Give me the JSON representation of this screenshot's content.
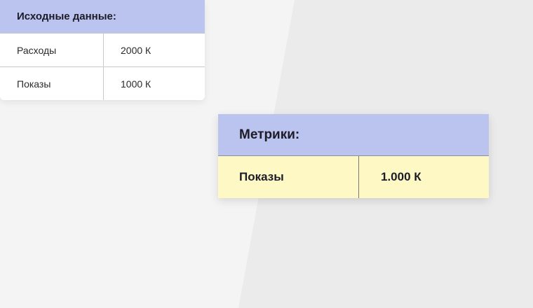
{
  "source_table": {
    "title": "Исходные данные:",
    "rows": [
      {
        "label": "Расходы",
        "value": "2000 К"
      },
      {
        "label": "Показы",
        "value": "1000 К"
      }
    ]
  },
  "metrics_table": {
    "title": "Метрики:",
    "rows": [
      {
        "label": "Показы",
        "value": "1.000 К"
      }
    ]
  },
  "colors": {
    "header_bg": "#bbc3ef",
    "metric_row_bg": "#fdf8c4",
    "page_bg_light": "#f4f4f4",
    "page_bg_dark": "#ebebeb"
  }
}
